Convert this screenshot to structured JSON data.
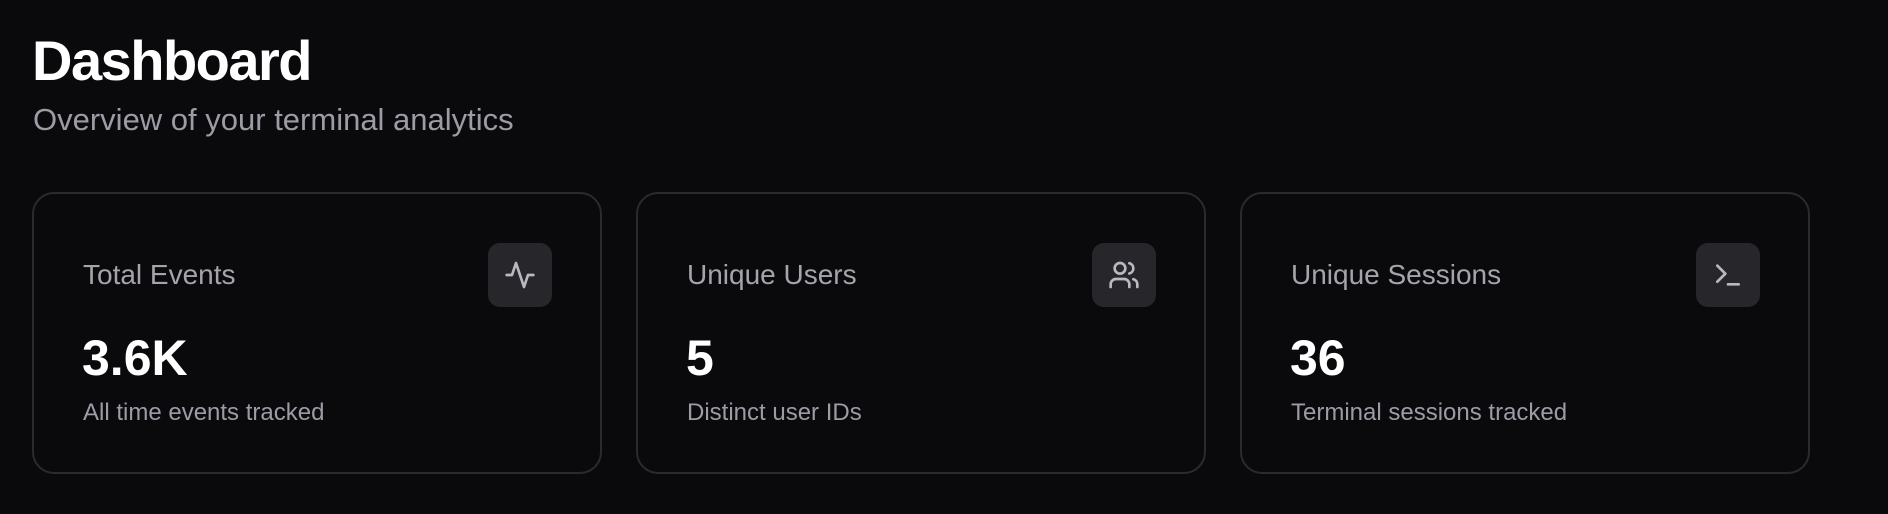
{
  "header": {
    "title": "Dashboard",
    "subtitle": "Overview of your terminal analytics"
  },
  "cards": [
    {
      "title": "Total Events",
      "value": "3.6K",
      "caption": "All time events tracked",
      "icon": "activity-icon"
    },
    {
      "title": "Unique Users",
      "value": "5",
      "caption": "Distinct user IDs",
      "icon": "users-icon"
    },
    {
      "title": "Unique Sessions",
      "value": "36",
      "caption": "Terminal sessions tracked",
      "icon": "terminal-icon"
    }
  ],
  "colors": {
    "background": "#0a0a0c",
    "card_border": "#2a2a2f",
    "icon_tile": "#27272b",
    "muted_text": "#9c9ca6",
    "primary_text": "#ffffff"
  }
}
